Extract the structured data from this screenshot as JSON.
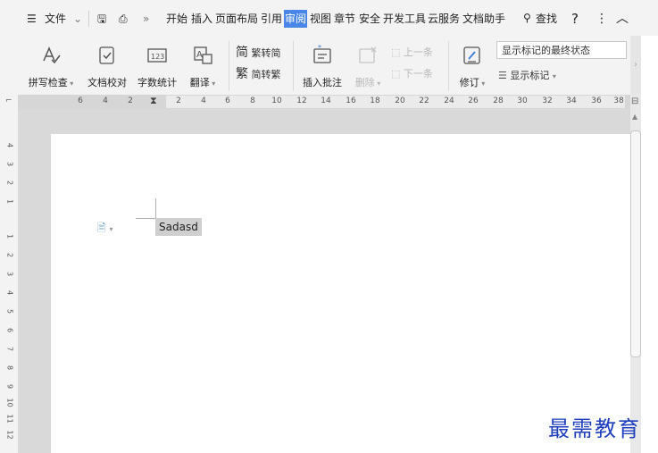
{
  "menubar": {
    "file_label": "文件",
    "tabs": [
      "开始",
      "插入",
      "页面布局",
      "引用",
      "审阅",
      "视图",
      "章节",
      "安全",
      "开发工具",
      "云服务",
      "文档助手"
    ],
    "active_tab": "审阅",
    "search_label": "查找",
    "help": "?",
    "more": "⋮",
    "collapse": "︿"
  },
  "ribbon": {
    "spellcheck": "拼写检查",
    "doc_proof": "文档校对",
    "word_count": "字数统计",
    "translate": "翻译",
    "trad_to_simp": "繁转简",
    "simp_to_trad": "简转繁",
    "insert_comment": "插入批注",
    "delete": "删除",
    "prev": "上一条",
    "next": "下一条",
    "revise": "修订",
    "show_markup": "显示标记",
    "display_state": "显示标记的最终状态"
  },
  "ruler": {
    "h_numbers": [
      "6",
      "4",
      "2",
      "2",
      "4",
      "6",
      "8",
      "10",
      "12",
      "14",
      "16",
      "18",
      "20",
      "22",
      "24",
      "26",
      "28",
      "30",
      "32",
      "34",
      "36",
      "38"
    ],
    "v_numbers": [
      "4",
      "3",
      "2",
      "1",
      "1",
      "2",
      "3",
      "4",
      "5",
      "6",
      "7",
      "8",
      "9",
      "10",
      "11",
      "12"
    ]
  },
  "document": {
    "text": "Sadasd"
  },
  "watermark": "最需教育"
}
